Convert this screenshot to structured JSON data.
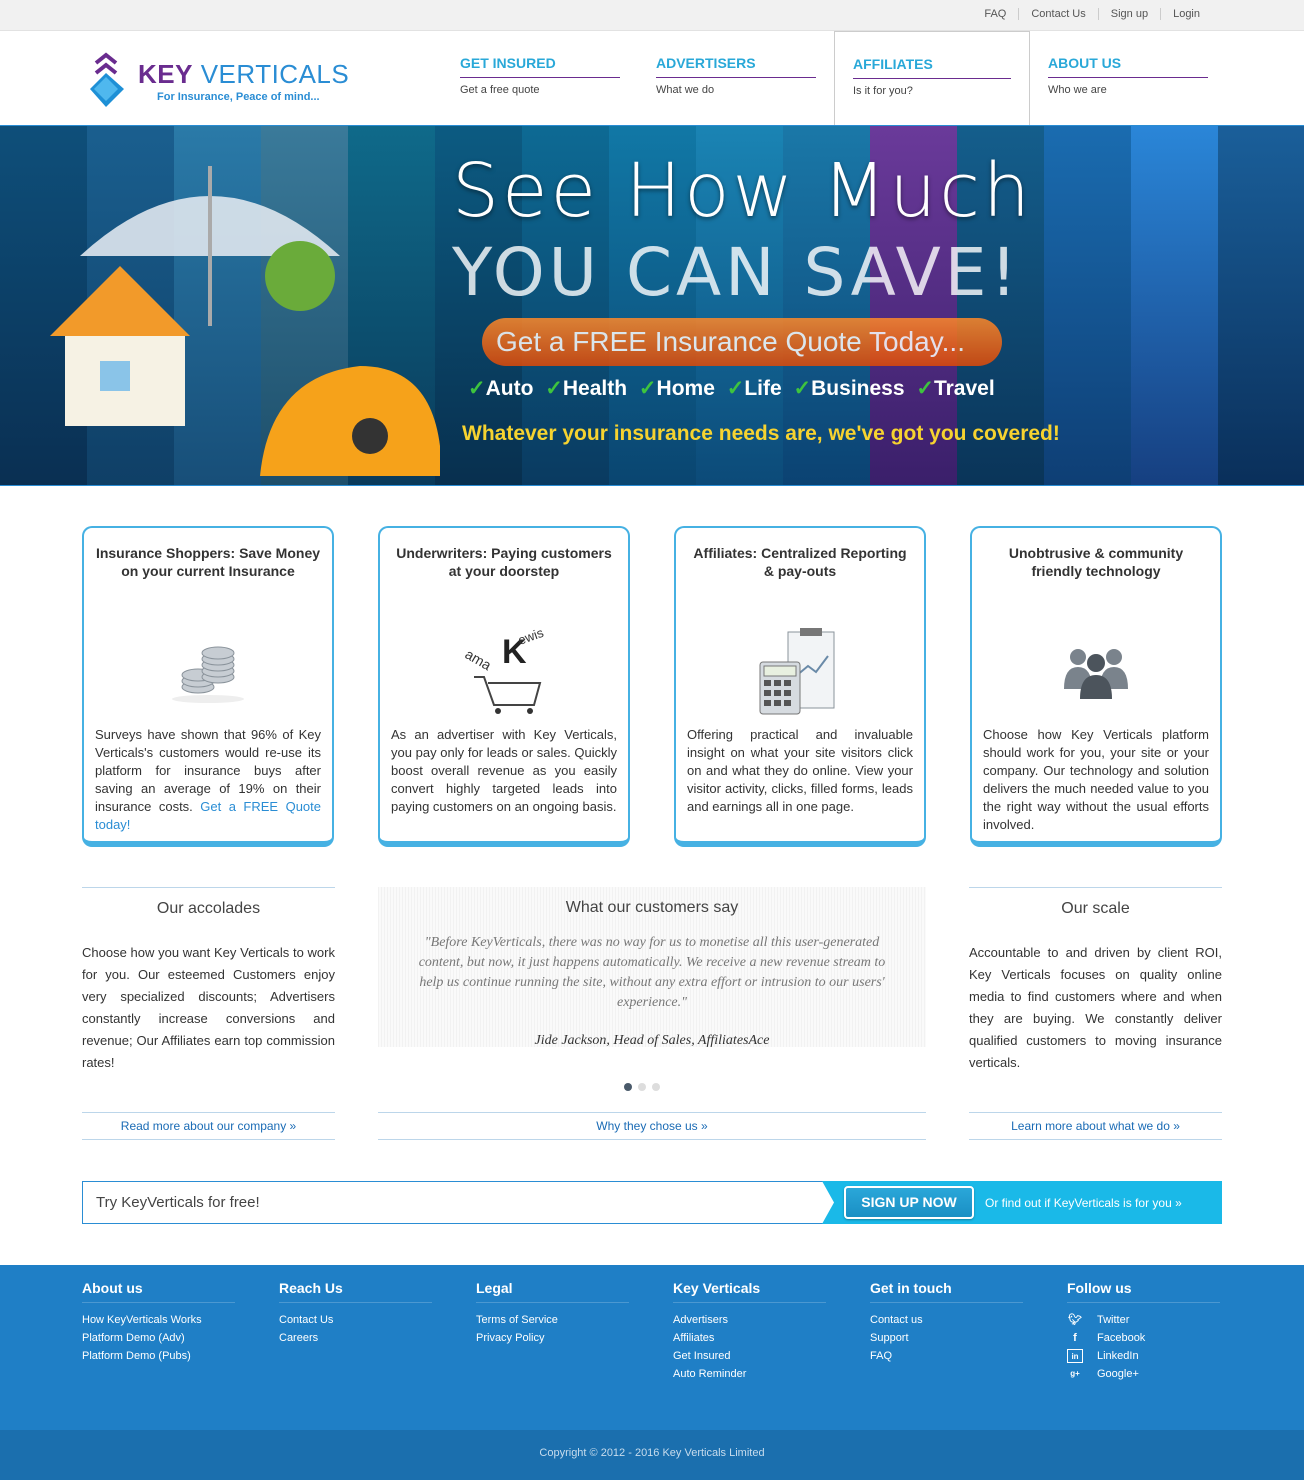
{
  "topbar": {
    "links": [
      "FAQ",
      "Contact Us",
      "Sign up",
      "Login"
    ]
  },
  "logo": {
    "brand_key": "KEY",
    "brand_verticals": "VERTICALS",
    "tagline": "For Insurance, Peace of mind..."
  },
  "nav": [
    {
      "title": "GET INSURED",
      "sub": "Get a free quote"
    },
    {
      "title": "ADVERTISERS",
      "sub": "What we do"
    },
    {
      "title": "AFFILIATES",
      "sub": "Is it for you?",
      "active": true
    },
    {
      "title": "ABOUT US",
      "sub": "Who we are"
    }
  ],
  "hero": {
    "line1": "See How Much",
    "line2": "YOU CAN SAVE!",
    "pill": "Get a FREE Insurance Quote Today...",
    "checks": [
      "Auto",
      "Health",
      "Home",
      "Life",
      "Business",
      "Travel"
    ],
    "tagline": "Whatever your insurance needs are, we've got you covered!"
  },
  "cards": [
    {
      "title": "Insurance Shoppers: Save Money on your current Insurance",
      "icon": "coins-icon",
      "text": "Surveys have shown that 96% of Key Verticals's customers would re-use its platform for insurance buys after saving an average of 19% on their insurance costs.",
      "link": "Get a FREE Quote today!"
    },
    {
      "title": "Underwriters: Paying customers at your doorstep",
      "icon": "shopping-cart-icon",
      "text": "As an advertiser with Key Verticals, you pay only for leads or sales. Quickly boost overall revenue as you easily convert highly targeted leads into paying customers on an ongoing basis.",
      "link": ""
    },
    {
      "title": "Affiliates: Centralized Reporting & pay-outs",
      "icon": "calculator-clipboard-icon",
      "text": "Offering practical and invaluable insight on what your site visitors click on and what they do online. View your visitor activity, clicks, filled forms, leads and earnings all in one page.",
      "link": ""
    },
    {
      "title": "Unobtrusive & community friendly technology",
      "icon": "people-group-icon",
      "text": "Choose how Key Verticals platform should work for you, your site or your company. Our technology and solution delivers the much needed value to you the right way without the usual efforts involved.",
      "link": ""
    }
  ],
  "accolades": {
    "title": "Our accolades",
    "text": "Choose how you want Key Verticals to work for you. Our esteemed Customers enjoy very specialized discounts; Advertisers constantly increase conversions and revenue; Our Affiliates earn top commission rates!",
    "more": "Read more about our company »"
  },
  "testimonials": {
    "title": "What our customers say",
    "quote": "\"Before KeyVerticals, there was no way for us to monetise all this user-generated content, but now, it just happens automatically. We receive a new revenue stream to help us continue running the site, without any extra effort or intrusion to our users' experience.\"",
    "author": "Jide Jackson, Head of Sales, AffiliatesAce",
    "more": "Why they chose us »"
  },
  "scale": {
    "title": "Our scale",
    "text": "Accountable to and driven by client ROI, Key Verticals focuses on quality online media to find customers where and when they are buying. We constantly deliver qualified customers to moving insurance verticals.",
    "more": "Learn more about what we do »"
  },
  "cta": {
    "try": "Try KeyVerticals for free!",
    "button": "SIGN UP NOW",
    "find": "Or find out if KeyVerticals is for you »"
  },
  "footer": {
    "cols": [
      {
        "title": "About us",
        "links": [
          "How KeyVerticals Works",
          "Platform Demo (Adv)",
          "Platform Demo (Pubs)"
        ]
      },
      {
        "title": "Reach Us",
        "links": [
          "Contact Us",
          "Careers"
        ]
      },
      {
        "title": "Legal",
        "links": [
          "Terms of Service",
          "Privacy Policy"
        ]
      },
      {
        "title": "Key Verticals",
        "links": [
          "Advertisers",
          "Affiliates",
          "Get Insured",
          "Auto Reminder"
        ]
      },
      {
        "title": "Get in touch",
        "links": [
          "Contact us",
          "Support",
          "FAQ"
        ]
      }
    ],
    "follow": {
      "title": "Follow us",
      "links": [
        {
          "label": "Twitter",
          "icon": "twitter-icon"
        },
        {
          "label": "Facebook",
          "icon": "facebook-icon"
        },
        {
          "label": "LinkedIn",
          "icon": "linkedin-icon"
        },
        {
          "label": "Google+",
          "icon": "googleplus-icon"
        }
      ]
    },
    "copyright": "Copyright © 2012 - 2016 Key Verticals Limited"
  },
  "colors": {
    "accent": "#29a8d8",
    "brand_purple": "#6a2c8f",
    "footer_bg": "#1f7fc6",
    "cta_blue": "#1ab9e8"
  }
}
